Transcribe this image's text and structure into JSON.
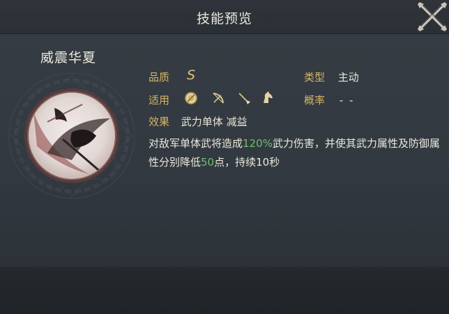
{
  "header": {
    "title": "技能预览"
  },
  "skill": {
    "name": "威震华夏",
    "quality_label": "品质",
    "quality_value": "S",
    "type_label": "类型",
    "type_value": "主动",
    "applicable_label": "适用",
    "applicable_icons": [
      "shield-icon",
      "bow-icon",
      "spear-icon",
      "horse-icon"
    ],
    "probability_label": "概率",
    "probability_value": "- -",
    "effect_label": "效果",
    "effect_value": "武力单体 减益",
    "description": {
      "part1": "对敌军单体武将造成",
      "value1": "120%",
      "part2": "武力伤害，并使其武力属性及防御属性分别降低",
      "value2": "50",
      "part3": "点，持续10秒"
    }
  },
  "colors": {
    "label": "#d6b566",
    "highlight": "#6fbf73",
    "text": "#ebe6da",
    "background": "#353c43"
  }
}
